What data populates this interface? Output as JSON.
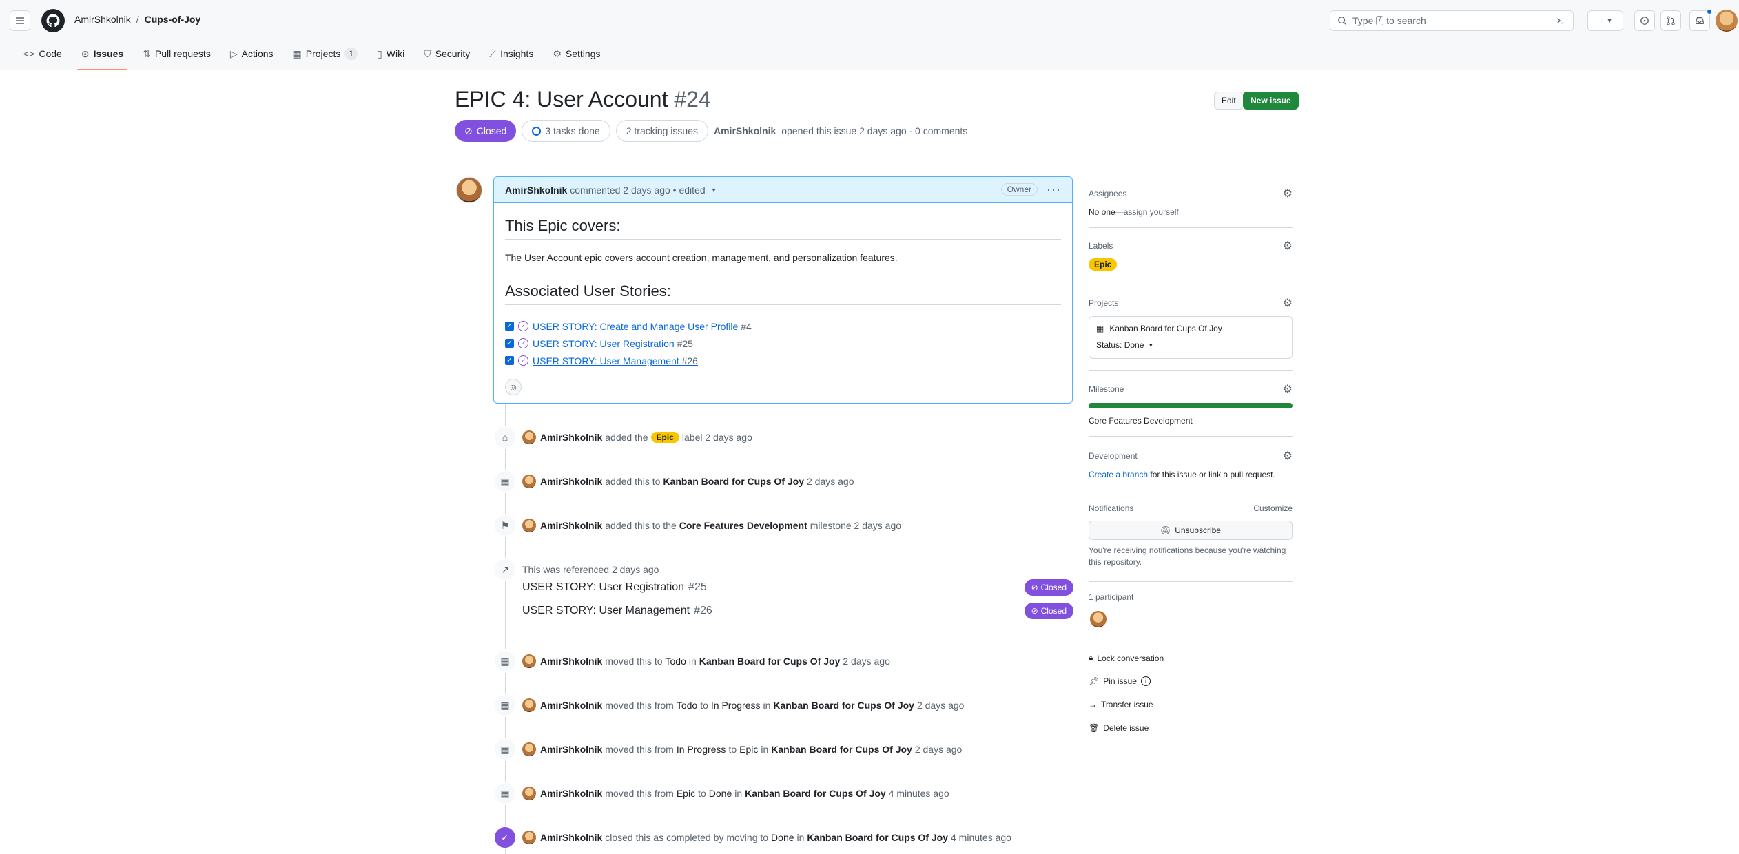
{
  "header": {
    "owner": "AmirShkolnik",
    "separator": "/",
    "repo": "Cups-of-Joy",
    "search_prefix": "Type",
    "search_key": "/",
    "search_suffix": "to search",
    "icons": [
      "hamburger-icon",
      "github-logo-icon",
      "terminal-icon",
      "plus-icon",
      "issue-icon",
      "pull-request-icon",
      "inbox-icon"
    ]
  },
  "tabs": [
    {
      "label": "Code",
      "icon": "code-icon"
    },
    {
      "label": "Issues",
      "icon": "issue-icon",
      "active": true
    },
    {
      "label": "Pull requests",
      "icon": "pull-request-icon"
    },
    {
      "label": "Actions",
      "icon": "play-icon"
    },
    {
      "label": "Projects",
      "icon": "table-icon",
      "count": "1"
    },
    {
      "label": "Wiki",
      "icon": "book-icon"
    },
    {
      "label": "Security",
      "icon": "shield-icon"
    },
    {
      "label": "Insights",
      "icon": "graph-icon"
    },
    {
      "label": "Settings",
      "icon": "gear-icon"
    }
  ],
  "issue": {
    "title": "EPIC 4: User Account",
    "number": "#24",
    "state": "Closed",
    "tasks_done": "3 tasks done",
    "tracking": "2 tracking issues",
    "author": "AmirShkolnik",
    "opened_text": "opened this issue 2 days ago · 0 comments",
    "edit_label": "Edit",
    "new_label": "New issue"
  },
  "comment": {
    "author": "AmirShkolnik",
    "meta": "commented 2 days ago • edited",
    "role": "Owner",
    "heading1": "This Epic covers:",
    "paragraph": "The User Account epic covers account creation, management, and personalization features.",
    "heading2": "Associated User Stories:",
    "tasks": [
      {
        "title": "USER STORY: Create and Manage User Profile",
        "num": "#4"
      },
      {
        "title": "USER STORY: User Registration",
        "num": "#25"
      },
      {
        "title": "USER STORY: User Management",
        "num": "#26"
      }
    ]
  },
  "timeline": {
    "ev1": {
      "author": "AmirShkolnik",
      "pre": "added the",
      "label": "Epic",
      "post": "label 2 days ago"
    },
    "ev2": {
      "author": "AmirShkolnik",
      "pre": "added this to",
      "board": "Kanban Board for Cups Of Joy",
      "post": "2 days ago"
    },
    "ev3": {
      "author": "AmirShkolnik",
      "pre": "added this to the",
      "milestone": "Core Features Development",
      "post": "milestone 2 days ago"
    },
    "ev4": {
      "text": "This was referenced 2 days ago",
      "refs": [
        {
          "title": "USER STORY: User Registration",
          "num": "#25",
          "state": "Closed"
        },
        {
          "title": "USER STORY: User Management",
          "num": "#26",
          "state": "Closed"
        }
      ]
    },
    "ev5": {
      "author": "AmirShkolnik",
      "a": "moved this to",
      "b": "Todo",
      "c": "in",
      "board": "Kanban Board for Cups Of Joy",
      "post": "2 days ago"
    },
    "ev6": {
      "author": "AmirShkolnik",
      "a": "moved this from",
      "b": "Todo",
      "c": "to",
      "d": "In Progress",
      "e": "in",
      "board": "Kanban Board for Cups Of Joy",
      "post": "2 days ago"
    },
    "ev7": {
      "author": "AmirShkolnik",
      "a": "moved this from",
      "b": "In Progress",
      "c": "to",
      "d": "Epic",
      "e": "in",
      "board": "Kanban Board for Cups Of Joy",
      "post": "2 days ago"
    },
    "ev8": {
      "author": "AmirShkolnik",
      "a": "moved this from",
      "b": "Epic",
      "c": "to",
      "d": "Done",
      "e": "in",
      "board": "Kanban Board for Cups Of Joy",
      "post": "4 minutes ago"
    },
    "ev9": {
      "author": "AmirShkolnik",
      "a": "closed this as",
      "b": "completed",
      "c": "by moving to",
      "d": "Done",
      "e": "in",
      "board": "Kanban Board for Cups Of Joy",
      "post": "4 minutes ago"
    }
  },
  "sidebar": {
    "assignees_title": "Assignees",
    "assignees_none": "No one—",
    "assign_yourself": "assign yourself",
    "labels_title": "Labels",
    "label": "Epic",
    "projects_title": "Projects",
    "project_name": "Kanban Board for Cups Of Joy",
    "project_status": "Status: Done",
    "milestone_title": "Milestone",
    "milestone_name": "Core Features Development",
    "milestone_progress": 1.0,
    "development_title": "Development",
    "create_branch": "Create a branch",
    "development_text": "for this issue or link a pull request.",
    "notifications_title": "Notifications",
    "customize": "Customize",
    "unsubscribe": "Unsubscribe",
    "notif_reason": "You're receiving notifications because you're watching this repository.",
    "participants": "1 participant",
    "lock": "Lock conversation",
    "pin": "Pin issue",
    "transfer": "Transfer issue",
    "delete": "Delete issue"
  },
  "colors": {
    "closed_purple": "#8250df",
    "primary_green": "#1f883d",
    "link_blue": "#0969da",
    "epic_yellow": "#f7c600",
    "tab_underline": "#fd8c73"
  }
}
